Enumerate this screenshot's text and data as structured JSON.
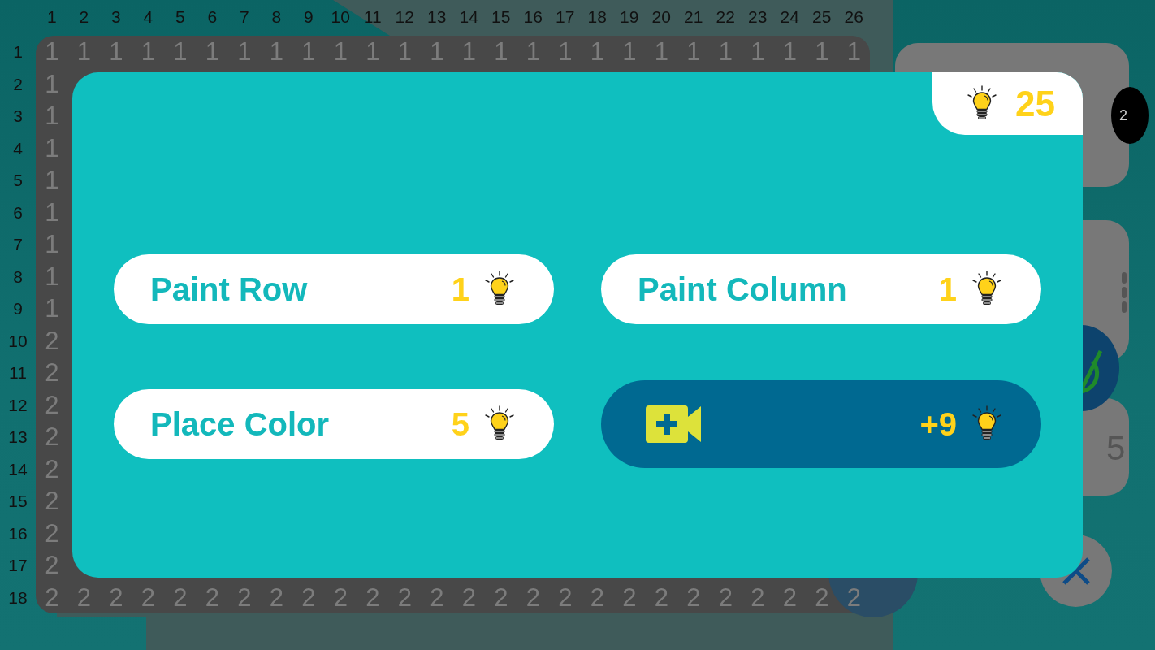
{
  "column_numbers": [
    "1",
    "2",
    "3",
    "4",
    "5",
    "6",
    "7",
    "8",
    "9",
    "10",
    "11",
    "12",
    "13",
    "14",
    "15",
    "16",
    "17",
    "18",
    "19",
    "20",
    "21",
    "22",
    "23",
    "24",
    "25",
    "26"
  ],
  "row_numbers": [
    "1",
    "2",
    "3",
    "4",
    "5",
    "6",
    "7",
    "8",
    "9",
    "10",
    "11",
    "12",
    "13",
    "14",
    "15",
    "16",
    "17",
    "18"
  ],
  "board": {
    "top_row": [
      "1",
      "1",
      "1",
      "1",
      "1",
      "1",
      "1",
      "1",
      "1",
      "1",
      "1",
      "1",
      "1",
      "1",
      "1",
      "1",
      "1",
      "1",
      "1",
      "1",
      "1",
      "1",
      "1",
      "1",
      "1",
      "1"
    ],
    "first_column": [
      "1",
      "1",
      "1",
      "1",
      "1",
      "1",
      "1",
      "1",
      "2",
      "2",
      "2",
      "2",
      "2",
      "2",
      "2",
      "2"
    ],
    "bottom_row": [
      "2",
      "2",
      "2",
      "2",
      "2",
      "2",
      "2",
      "2",
      "2",
      "2",
      "2",
      "2",
      "2",
      "2",
      "2",
      "2",
      "2",
      "2",
      "2",
      "2",
      "2",
      "2",
      "2",
      "2",
      "2",
      "2"
    ]
  },
  "side_panel": {
    "count_badge": "2",
    "number": "5"
  },
  "dialog": {
    "hint_count": "25",
    "actions": [
      {
        "kind": "action",
        "label": "Paint Row",
        "cost": "1"
      },
      {
        "kind": "action",
        "label": "Paint Column",
        "cost": "1"
      },
      {
        "kind": "action",
        "label": "Place Color",
        "cost": "5"
      },
      {
        "kind": "video",
        "reward": "+9"
      }
    ]
  }
}
